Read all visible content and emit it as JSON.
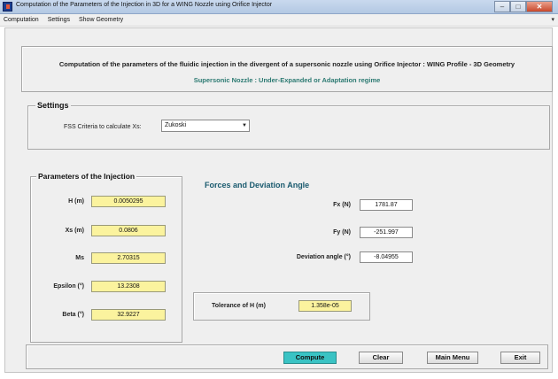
{
  "window": {
    "title": "Computation of the Parameters of the Injection in 3D for a WING Nozzle using Orifice Injector",
    "minimize_glyph": "–",
    "maximize_glyph": "□",
    "close_glyph": "✕"
  },
  "menu": {
    "items": [
      "Computation",
      "Settings",
      "Show Geometry"
    ],
    "overflow_glyph": "▾"
  },
  "header": {
    "title": "Computation of the parameters of the fluidic injection in the divergent of a supersonic nozzle using Orifice Injector : WING Profile - 3D Geometry",
    "subtitle": "Supersonic Nozzle  : Under-Expanded or Adaptation regime",
    "subtitle_color": "#2c7a72"
  },
  "settings": {
    "legend": "Settings",
    "fss_label": "FSS Criteria to calculate Xs:",
    "fss_value": "Zukoski",
    "dropdown_glyph": "▼"
  },
  "parameters": {
    "legend": "Parameters of the Injection",
    "rows": [
      {
        "label": "H (m)",
        "value": "0.0050295"
      },
      {
        "label": "Xs (m)",
        "value": "0.0806"
      },
      {
        "label": "Ms",
        "value": "2.70315"
      },
      {
        "label": "Epsilon (°)",
        "value": "13.2308"
      },
      {
        "label": "Beta (°)",
        "value": "32.9227"
      }
    ],
    "field_color": "#fbf39e"
  },
  "forces": {
    "title": "Forces and Deviation Angle",
    "rows": [
      {
        "label": "Fx (N)",
        "value": "1781.87"
      },
      {
        "label": "Fy (N)",
        "value": "-251.997"
      },
      {
        "label": "Deviation angle (°)",
        "value": "-8.04955"
      }
    ],
    "title_color": "#1a5a6e"
  },
  "tolerance": {
    "label": "Tolerance of H (m)",
    "value": "1.358e-05"
  },
  "buttons": {
    "compute": "Compute",
    "clear": "Clear",
    "main_menu": "Main Menu",
    "exit": "Exit",
    "compute_color": "#3ac3c4"
  }
}
